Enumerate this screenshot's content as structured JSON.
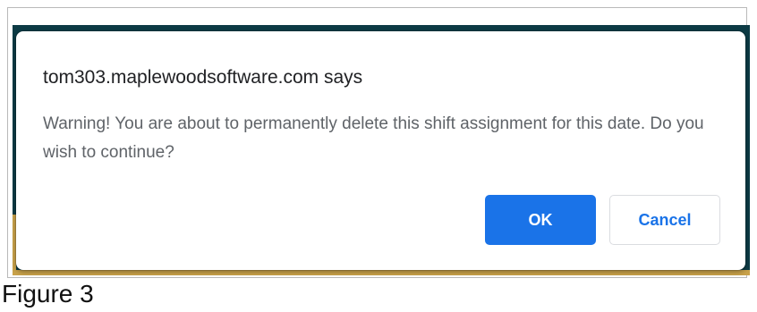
{
  "dialog": {
    "title": "tom303.maplewoodsoftware.com says",
    "message": "Warning! You are about to permanently delete this shift assignment for this date. Do you wish to continue?",
    "ok_label": "OK",
    "cancel_label": "Cancel"
  },
  "caption": "Figure 3",
  "colors": {
    "backdrop": "#0d3b45",
    "backdrop_accent": "#c9a24a",
    "ok_button": "#1a73e8",
    "cancel_text": "#1a73e8"
  }
}
